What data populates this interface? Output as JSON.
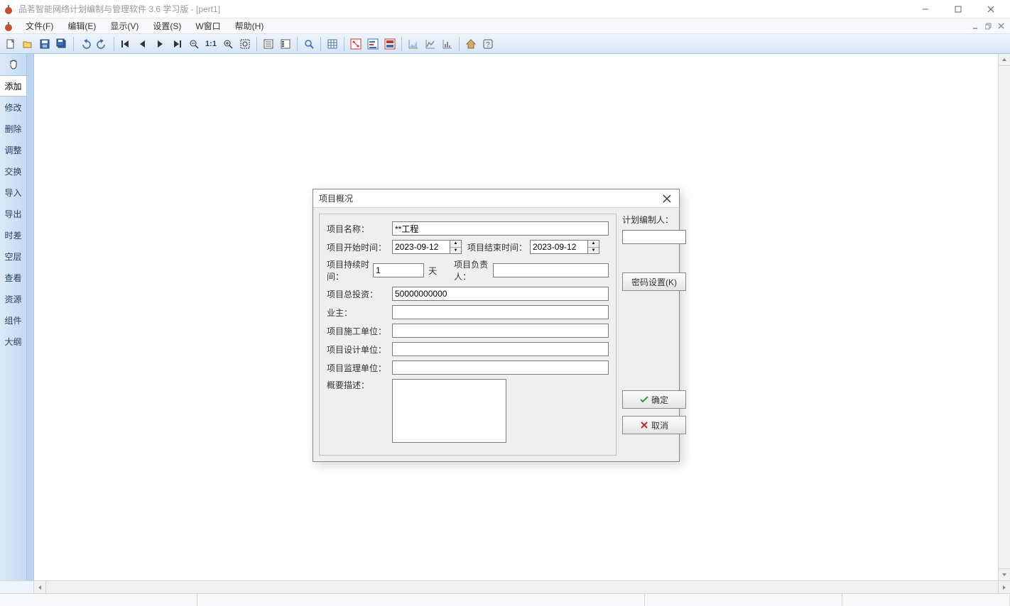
{
  "window": {
    "title": "品茗智能网络计划编制与管理软件 3.6 学习版 - [pert1]"
  },
  "menu": {
    "file": "文件(F)",
    "edit": "编辑(E)",
    "view": "显示(V)",
    "settings": "设置(S)",
    "window": "W窗口",
    "help": "帮助(H)"
  },
  "toolbar": {
    "new": "new-file",
    "open": "open-file",
    "save": "save",
    "save_all": "save-all",
    "undo": "undo",
    "redo": "redo",
    "first": "nav-first",
    "prev": "nav-prev",
    "next": "nav-next",
    "last": "nav-last",
    "zoom_out": "zoom-out",
    "zoom_11": "1:1",
    "zoom_in": "zoom-in",
    "zoom_fit": "zoom-fit",
    "props": "properties",
    "list": "list-view",
    "find": "find",
    "grid": "grid",
    "mode_net": "network",
    "mode_bar": "bar",
    "mode_mixed": "mixed",
    "chart1": "chart-1",
    "chart2": "chart-2",
    "chart3": "chart-3",
    "home": "home",
    "help": "help"
  },
  "left_tools": {
    "hand": "拖动",
    "add": "添加",
    "modify": "修改",
    "delete": "删除",
    "adjust": "调整",
    "swap": "交换",
    "import": "导入",
    "export": "导出",
    "slack": "时差",
    "layer": "空层",
    "view": "查看",
    "resource": "资源",
    "component": "组件",
    "outline": "大纲"
  },
  "dialog": {
    "title": "项目概况",
    "labels": {
      "name": "项目名称：",
      "start": "项目开始时间：",
      "end": "项目结束时间：",
      "duration": "项目持续时间：",
      "unit_day": "天",
      "manager": "项目负责人：",
      "investment": "项目总投资：",
      "owner": "业主：",
      "constructor": "项目施工单位：",
      "designer": "项目设计单位：",
      "supervisor": "项目监理单位：",
      "summary": "概要描述：",
      "planner": "计划编制人："
    },
    "values": {
      "name": "**工程",
      "start": "2023-09-12",
      "end": "2023-09-12",
      "duration": "1",
      "manager": "",
      "investment": "50000000000",
      "owner": "",
      "constructor": "",
      "designer": "",
      "supervisor": "",
      "summary": "",
      "planner": ""
    },
    "buttons": {
      "password": "密码设置(K)",
      "ok": "确定",
      "cancel": "取消"
    }
  }
}
